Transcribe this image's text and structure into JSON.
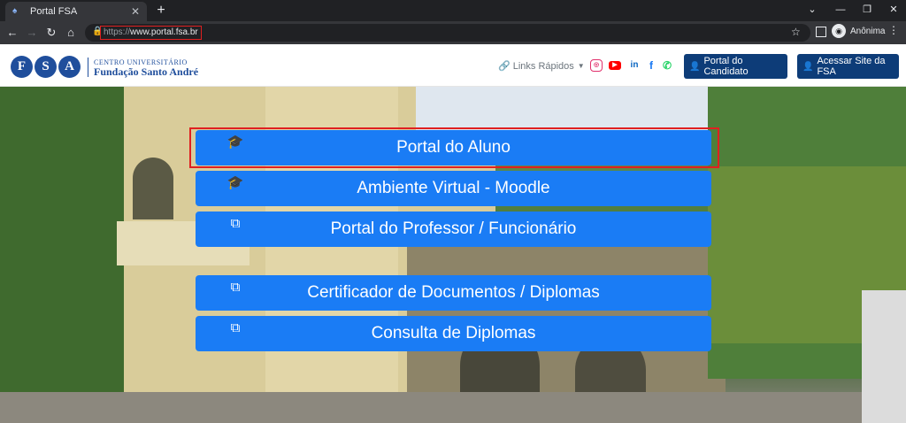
{
  "browser": {
    "tab_title": "Portal FSA",
    "tab_favicon": "fsa-favicon-icon",
    "new_tab": "+",
    "url_scheme": "https://",
    "url_host": "www.portal.fsa.br",
    "profile_label": "Anônima"
  },
  "site": {
    "logo_letters": [
      "F",
      "S",
      "A"
    ],
    "logo_line1": "CENTRO UNIVERSITÁRIO",
    "logo_line2": "Fundação Santo André",
    "quick_links": "Links Rápidos",
    "social": [
      "instagram-icon",
      "youtube-icon",
      "linkedin-icon",
      "facebook-icon",
      "whatsapp-icon"
    ],
    "social_colors": {
      "instagram": "#e1306c",
      "youtube": "#ff0000",
      "linkedin": "#0a66c2",
      "facebook": "#1877f2",
      "whatsapp": "#25d366"
    },
    "btn_candidate": "Portal do Candidato",
    "btn_site": "Acessar Site da FSA"
  },
  "portals": [
    {
      "label": "Portal do Aluno",
      "icon": "graduate-icon"
    },
    {
      "label": "Ambiente Virtual - Moodle",
      "icon": "graduate-icon"
    },
    {
      "label": "Portal do Professor / Funcionário",
      "icon": "teacher-board-icon"
    },
    {
      "label": "Certificador de Documentos / Diplomas",
      "icon": "teacher-board-icon"
    },
    {
      "label": "Consulta de Diplomas",
      "icon": "teacher-board-icon"
    }
  ],
  "colors": {
    "portal_button": "#1a7cf5",
    "nav_button": "#0d3c78",
    "highlight": "#e02020"
  }
}
